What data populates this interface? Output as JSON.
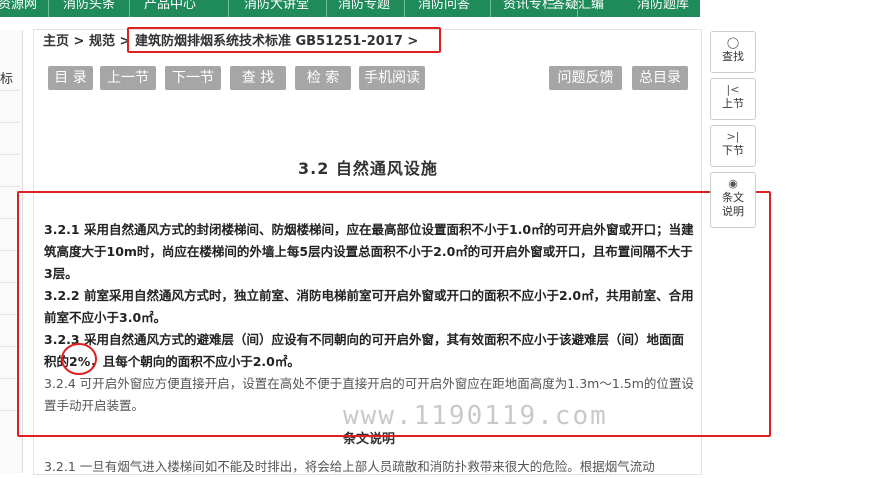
{
  "topnav": {
    "items": [
      "资源网",
      "消防头条",
      "产品中心",
      "消防大讲堂",
      "消防专题",
      "消防问答",
      "资讯专栏",
      "答疑汇编",
      "消防题库"
    ]
  },
  "sidebar_fragment": {
    "text": "标"
  },
  "breadcrumb": {
    "home": "主页",
    "sep1": ">",
    "standards": "规范",
    "sep2": ">",
    "current": "建筑防烟排烟系统技术标准 GB51251-2017",
    "sep3": ">"
  },
  "toolbar": {
    "toc": "目 录",
    "prev": "上一节",
    "next": "下一节",
    "find": "查 找",
    "search": "检 索",
    "mobile": "手机阅读",
    "feedback": "问题反馈",
    "master_toc": "总目录"
  },
  "section_title": "3.2  自然通风设施",
  "paragraphs": [
    {
      "line": "3.2.1 采用自然通风方式的封闭楼梯间、防烟楼梯间，应在最高部位设置面积不小于1.0㎡的可开启外窗或开口；当建"
    },
    {
      "line": "筑高度大于10m时，尚应在楼梯间的外墙上每5层内设置总面积不小于2.0㎡的可开启外窗或开口，且布置间隔不大于"
    },
    {
      "line": "3层。"
    },
    {
      "line": "3.2.2 前室采用自然通风方式时，独立前室、消防电梯前室可开启外窗或开口的面积不应小于2.0㎡，共用前室、合用"
    },
    {
      "line": "前室不应小于3.0㎡。"
    },
    {
      "line": "3.2.3 采用自然通风方式的避难层（间）应设有不同朝向的可开启外窗，其有效面积不应小于该避难层（间）地面面"
    },
    {
      "line": "积的2%，且每个朝向的面积不应小于2.0㎡。"
    },
    {
      "line": "3.2.4 可开启外窗应方便直接开启，设置在高处不便于直接开启的可开启外窗应在距地面高度为1.3m～1.5m的位置设"
    },
    {
      "line": "置手动开启装置。"
    }
  ],
  "watermark": "www.1190119.com",
  "commentary_title": "条文说明",
  "commentary_first_line": "3.2.1 一旦有烟气进入楼梯间如不能及时排出，将会给上部人员疏散和消防扑救带来很大的危险。根据烟气流动",
  "rightbar": {
    "find": {
      "icon": "search-icon",
      "label": "查找"
    },
    "prev": {
      "icon": "prev-icon",
      "label": "上节"
    },
    "next": {
      "icon": "next-icon",
      "label": "下节"
    },
    "explain": {
      "icon": "eye-icon",
      "label": "条文说明"
    }
  },
  "colors": {
    "nav_green": "#1f8a5a",
    "button_gray": "#a6a6a6",
    "annotation_red": "#e02020"
  }
}
